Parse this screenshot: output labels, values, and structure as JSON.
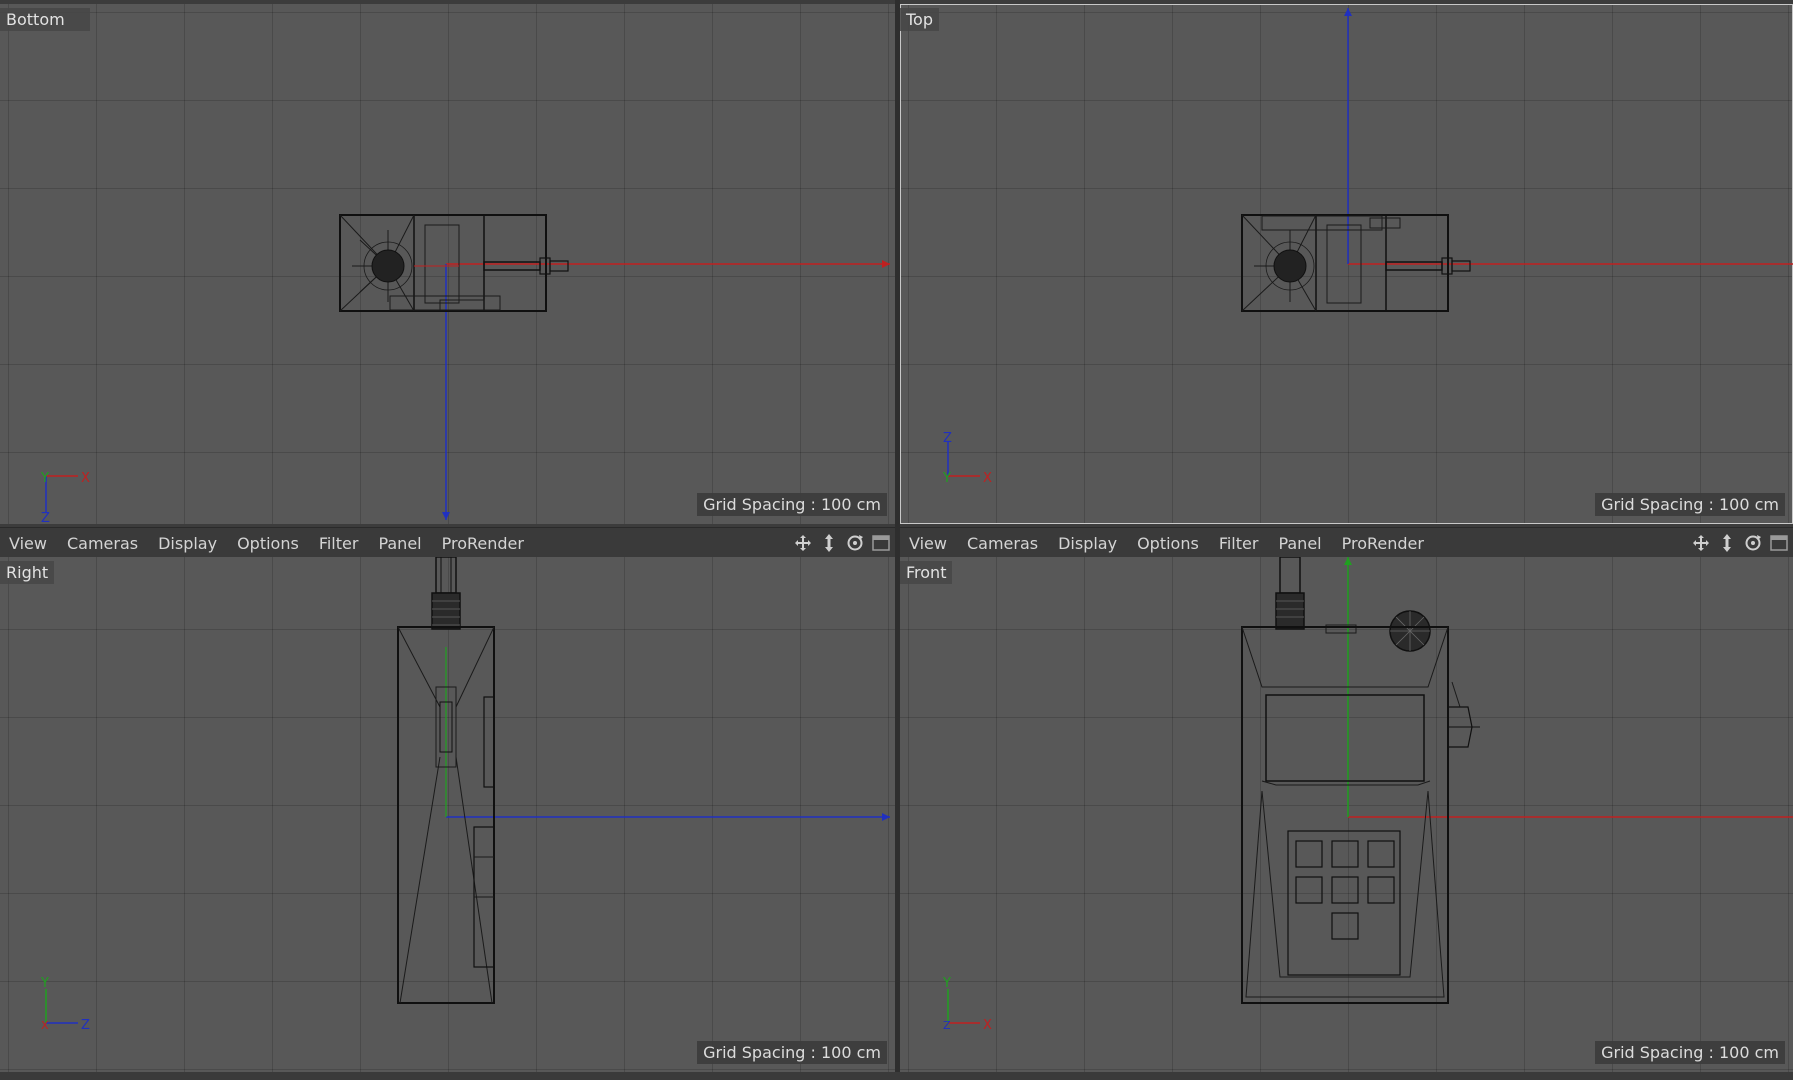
{
  "viewports": {
    "bottom": {
      "label": "Bottom",
      "grid": "Grid Spacing : 100 cm",
      "axis_h": "X",
      "axis_v": "Y",
      "axis_depth": "Z"
    },
    "top": {
      "label": "Top",
      "grid": "Grid Spacing : 100 cm",
      "axis_h": "X",
      "axis_v": "Z",
      "axis_depth": "Y"
    },
    "right": {
      "label": "Right",
      "grid": "Grid Spacing : 100 cm",
      "axis_h": "Z",
      "axis_v": "Y",
      "axis_depth": "X"
    },
    "front": {
      "label": "Front",
      "grid": "Grid Spacing : 100 cm",
      "axis_h": "X",
      "axis_v": "Y",
      "axis_depth": "Z"
    }
  },
  "menubar_left": {
    "items": [
      "View",
      "Cameras",
      "Display",
      "Options",
      "Filter",
      "Panel",
      "ProRender"
    ]
  },
  "menubar_right": {
    "items": [
      "View",
      "Cameras",
      "Display",
      "Options",
      "Filter",
      "Panel",
      "ProRender"
    ]
  },
  "colors": {
    "viewport_bg": "#585858",
    "axis_x": "#c02020",
    "axis_y": "#20a020",
    "axis_z": "#2030c0",
    "wire": "#101010",
    "active_border": "#c8c8c8"
  },
  "icons": [
    "move-view-icon",
    "zoom-view-icon",
    "rotate-view-icon",
    "toggle-layout-icon"
  ]
}
